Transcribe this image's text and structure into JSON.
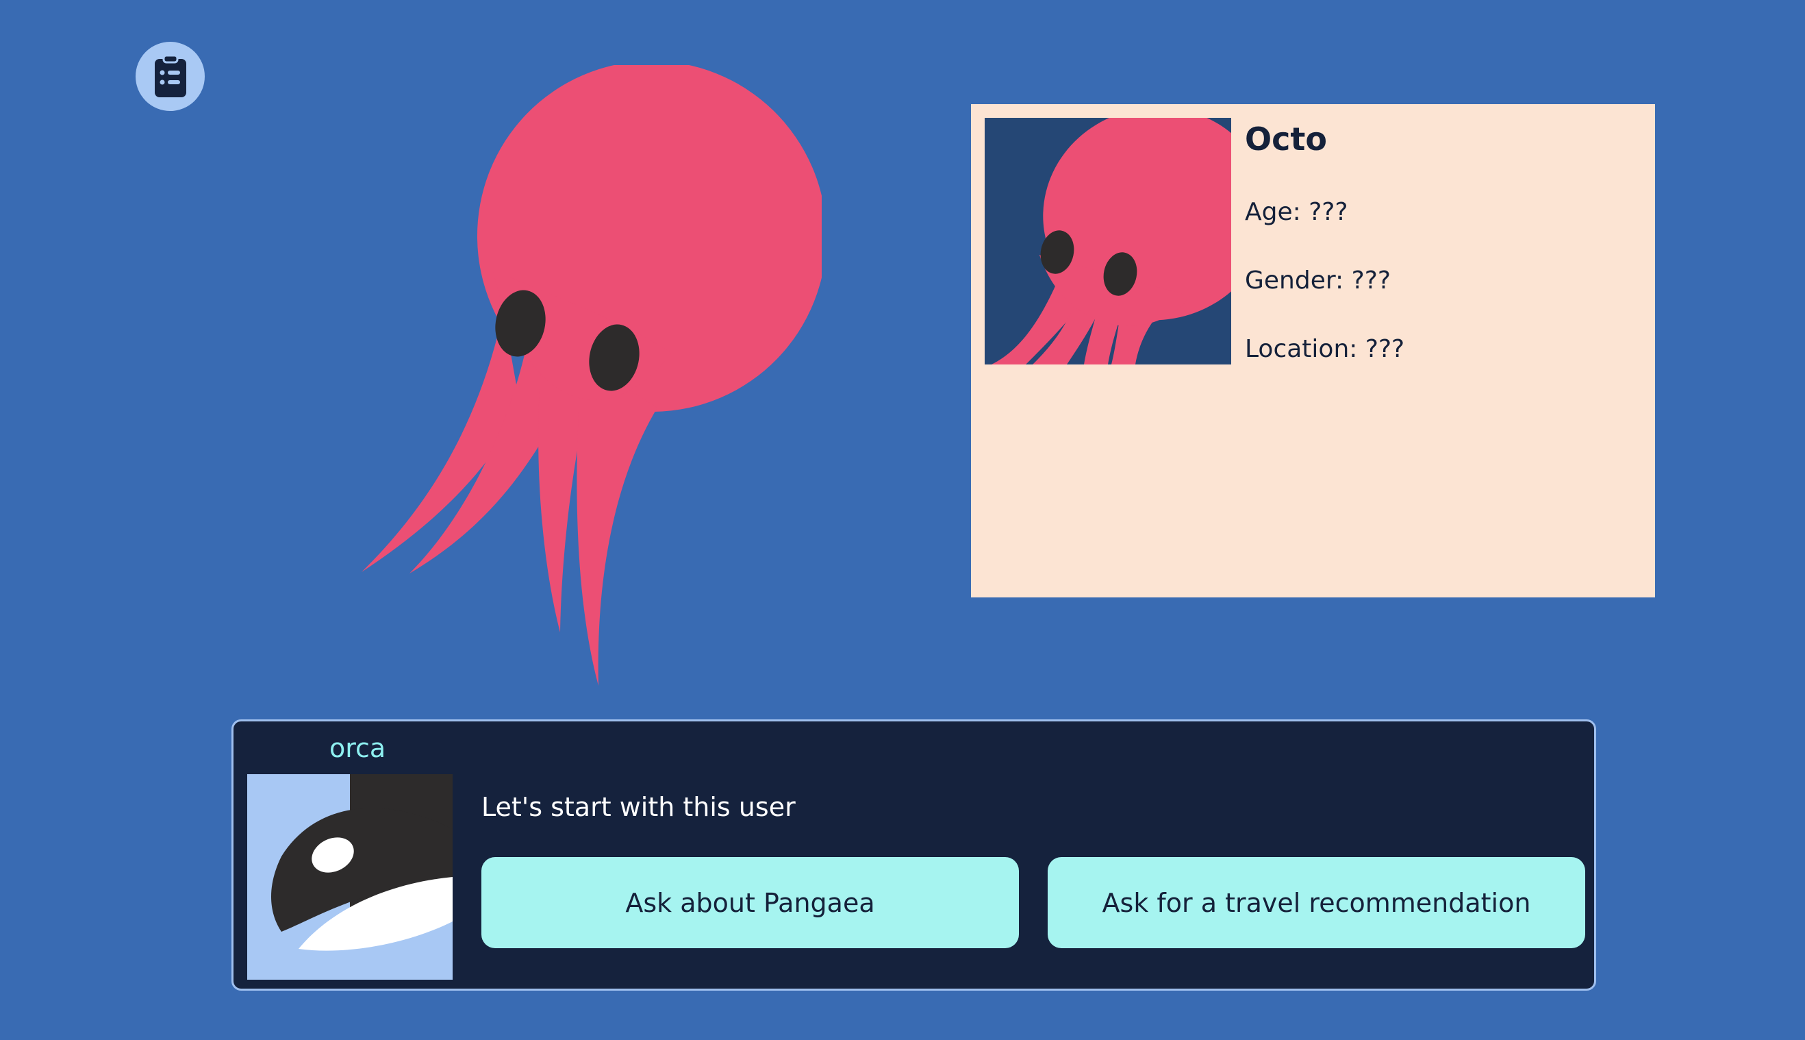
{
  "quest_button": {
    "icon": "clipboard-list-icon"
  },
  "profile": {
    "name": "Octo",
    "age": "Age: ???",
    "gender": "Gender: ???",
    "location": "Location: ???"
  },
  "dialog": {
    "speaker": "orca",
    "message": "Let's start with this user",
    "choices": [
      {
        "label": "Ask about Pangaea"
      },
      {
        "label": "Ask for a travel recommendation"
      }
    ]
  },
  "colors": {
    "background": "#396bb3",
    "octopus": "#ec4f74",
    "card": "#fce4d3",
    "dialog": "#15223d",
    "choice": "#a6f4f0",
    "speaker": "#8ef0f0"
  }
}
